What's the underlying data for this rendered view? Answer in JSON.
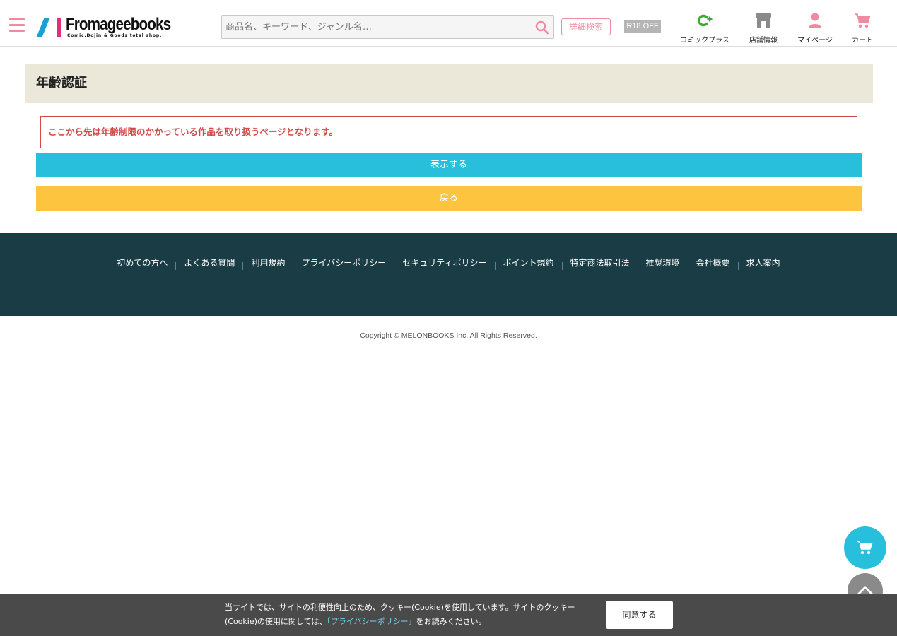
{
  "header": {
    "logo_text": "Fromageebooks",
    "logo_tagline": "Comic,Dojin & Goods total shop.",
    "search": {
      "placeholder": "商品名、キーワード、ジャンル名…",
      "value": ""
    },
    "advanced_search_label": "詳細検索",
    "r18_toggle_label": "R18 OFF",
    "nav": [
      {
        "label": "コミックプラス",
        "icon": "comic-plus-icon",
        "color": "#3aab2f"
      },
      {
        "label": "店舗情報",
        "icon": "store-icon",
        "color": "#8a8a8a"
      },
      {
        "label": "マイページ",
        "icon": "user-icon",
        "color": "#f08aa0"
      },
      {
        "label": "カート",
        "icon": "cart-icon",
        "color": "#f08aa0"
      }
    ]
  },
  "main": {
    "title": "年齢認証",
    "notice": "ここから先は年齢制限のかかっている作品を取り扱うページとなります。",
    "show_button_label": "表示する",
    "back_button_label": "戻る"
  },
  "footer": {
    "links": [
      "初めての方へ",
      "よくある質問",
      "利用規約",
      "プライバシーポリシー",
      "セキュリティポリシー",
      "ポイント規約",
      "特定商法取引法",
      "推奨環境",
      "会社概要",
      "求人案内"
    ],
    "copyright": "Copyright © MELONBOOKS Inc. All Rights Reserved."
  },
  "cookie_banner": {
    "text_part1": "当サイトでは、サイトの利便性向上のため、クッキー(Cookie)を使用しています。サイトのクッキー(Cookie)の使用に関しては、",
    "link_text": "「プライバシーポリシー」",
    "text_part2": "をお読みください。",
    "agree_label": "同意する"
  },
  "colors": {
    "accent_pink": "#f08aa0",
    "accent_cyan": "#27bfdb",
    "accent_yellow": "#fcc43f",
    "notice_red": "#d04a4a",
    "footer_bg": "#1a3d45",
    "title_bg": "#ebe8da"
  }
}
